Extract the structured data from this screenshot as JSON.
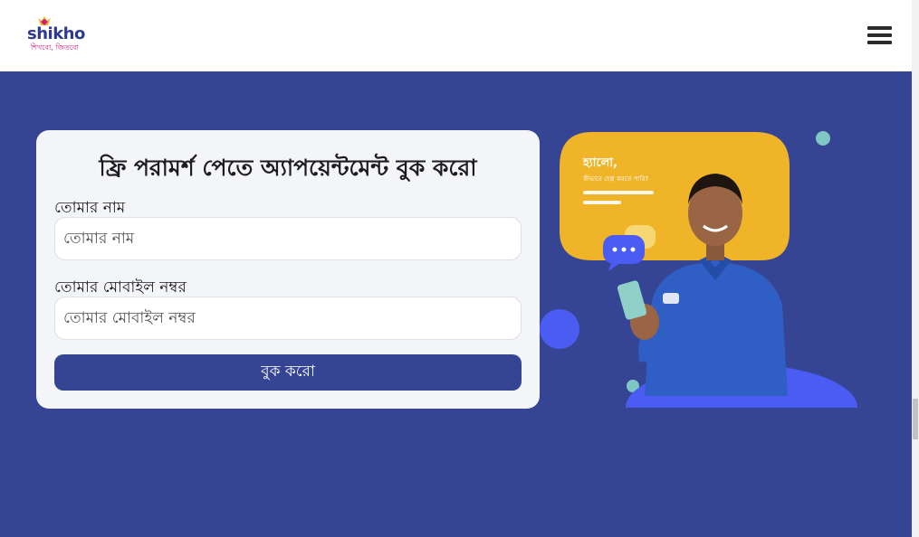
{
  "header": {
    "logo_text": "shikho",
    "logo_tagline": "শিখবো, জিতবো",
    "menu_icon": "hamburger-menu-icon"
  },
  "form": {
    "title": "ফ্রি পরামর্শ পেতে অ্যাপয়েন্টমেন্ট বুক করো",
    "name_label": "তোমার নাম",
    "name_placeholder": "তোমার নাম",
    "mobile_label": "তোমার মোবাইল নম্বর",
    "mobile_placeholder": "তোমার মোবাইল নম্বর",
    "submit_label": "বুক করো"
  },
  "illustration": {
    "bubble_title": "হ্যালো,",
    "bubble_subtitle": "কীভাবে হেল্প করতে পারি?"
  },
  "colors": {
    "background": "#364593",
    "card": "#f4f5f9",
    "button": "#364593",
    "bubble": "#f0b429",
    "shirt": "#2f5fc4",
    "accent_teal": "#7fc6c4",
    "accent_blue": "#4a5cf2"
  }
}
